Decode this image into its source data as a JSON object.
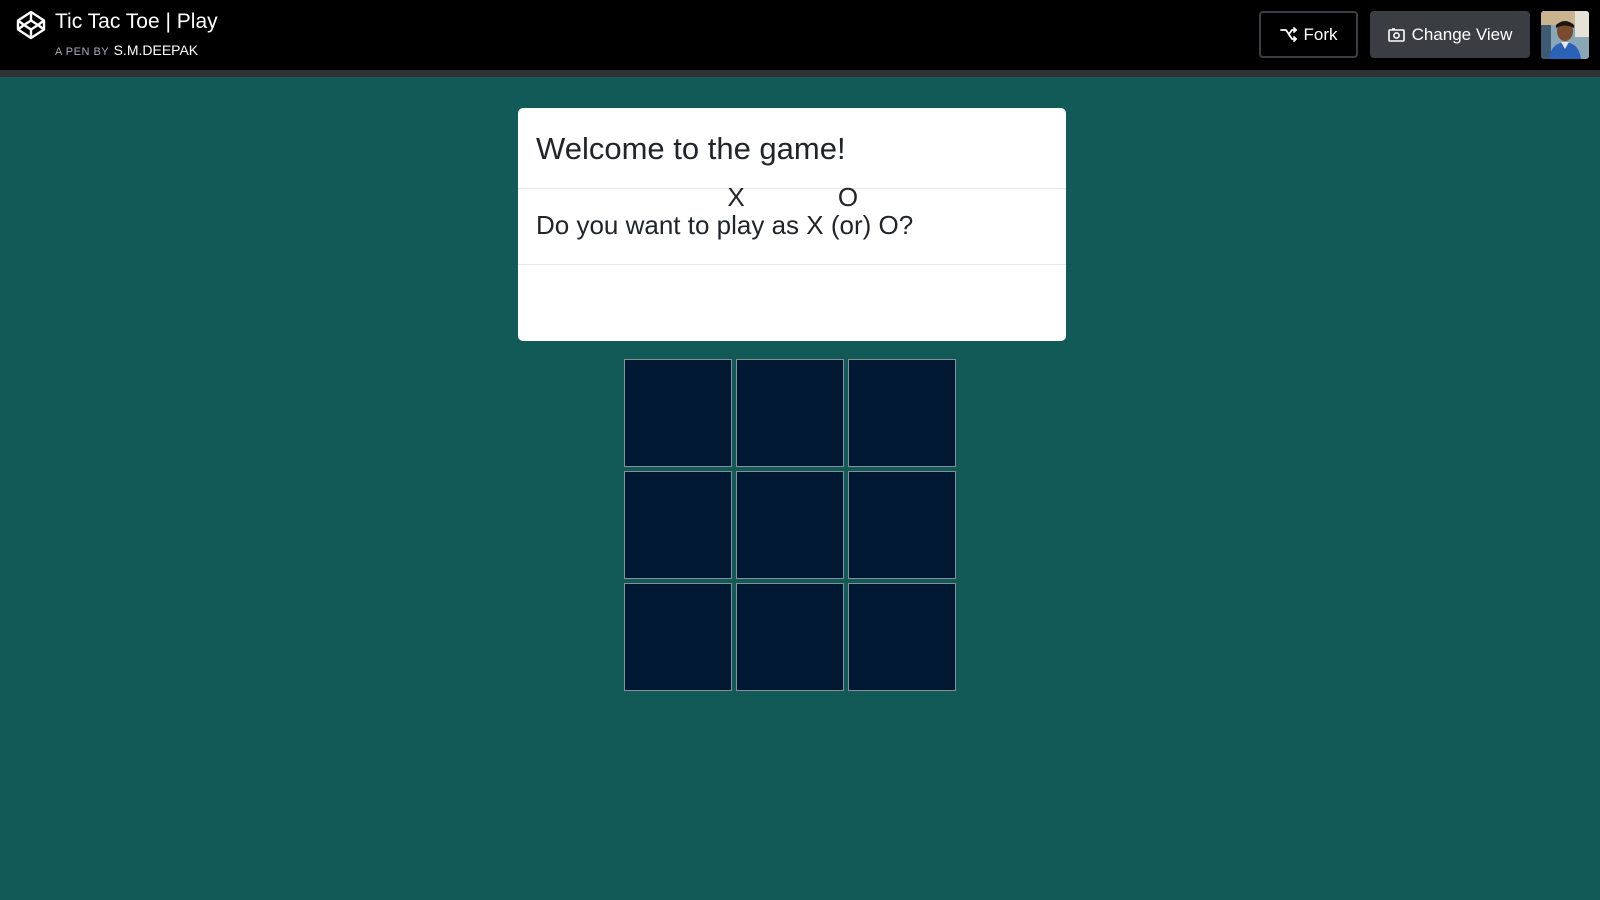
{
  "header": {
    "title": "Tic Tac Toe | Play",
    "byline_prefix": "A PEN BY",
    "author": "S.M.DEEPAK",
    "fork_label": "Fork",
    "change_view_label": "Change View",
    "logo_icon": "codepen-logo-icon",
    "fork_icon": "fork-icon",
    "change_view_icon": "eye-icon"
  },
  "modal": {
    "title": "Welcome to the game!",
    "question": "Do you want to play as X (or) O?",
    "choices": [
      "X",
      "O"
    ]
  },
  "board": {
    "cells": [
      "",
      "",
      "",
      "",
      "",
      "",
      "",
      "",
      ""
    ]
  },
  "colors": {
    "background": "#125a58",
    "topbar": "#000000",
    "cell": "#001832",
    "modal": "#ffffff"
  }
}
